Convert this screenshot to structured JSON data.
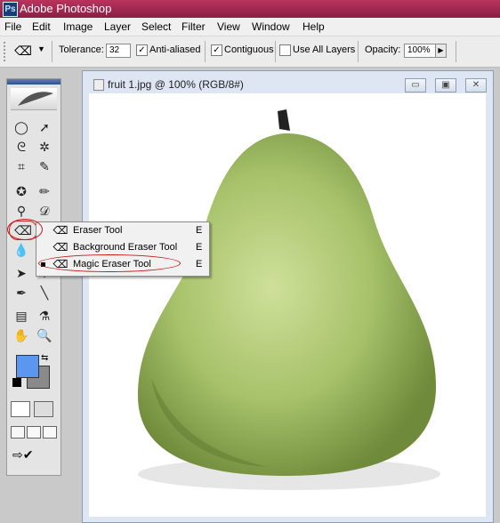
{
  "app": {
    "title": "Adobe Photoshop",
    "logo_text": "Ps"
  },
  "menu": [
    "File",
    "Edit",
    "Image",
    "Layer",
    "Select",
    "Filter",
    "View",
    "Window",
    "Help"
  ],
  "options": {
    "tool_icon": "magic-eraser-icon",
    "tolerance_label": "Tolerance:",
    "tolerance_value": "32",
    "antialiased_label": "Anti-aliased",
    "antialiased_checked": true,
    "contiguous_label": "Contiguous",
    "contiguous_checked": true,
    "use_all_layers_label": "Use All Layers",
    "use_all_layers_checked": false,
    "opacity_label": "Opacity:",
    "opacity_value": "100%"
  },
  "document": {
    "title": "fruit 1.jpg @ 100% (RGB/8#)",
    "controls": [
      "minimize",
      "restore",
      "close"
    ]
  },
  "flyout": {
    "items": [
      {
        "label": "Eraser Tool",
        "shortcut": "E",
        "icon": "eraser-icon",
        "active": false
      },
      {
        "label": "Background Eraser Tool",
        "shortcut": "E",
        "icon": "background-eraser-icon",
        "active": false
      },
      {
        "label": "Magic Eraser Tool",
        "shortcut": "E",
        "icon": "magic-eraser-icon",
        "active": true
      }
    ]
  },
  "colors": {
    "foreground": "#5b96f0",
    "background": "#8a8a8a",
    "titlebar": "#a82c52",
    "highlight_ring": "#c41a1a"
  }
}
